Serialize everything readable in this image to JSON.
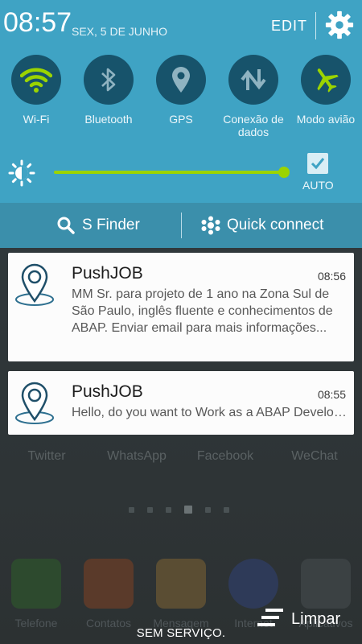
{
  "status": {
    "time": "08:57",
    "date": "SEX, 5 DE JUNHO",
    "edit_label": "EDIT"
  },
  "toggles": [
    {
      "label": "Wi-Fi",
      "icon": "wifi-icon",
      "active": true
    },
    {
      "label": "Bluetooth",
      "icon": "bluetooth-icon",
      "active": false
    },
    {
      "label": "GPS",
      "icon": "gps-icon",
      "active": false
    },
    {
      "label": "Conexão de dados",
      "icon": "data-connection-icon",
      "active": false
    },
    {
      "label": "Modo avião",
      "icon": "airplane-icon",
      "active": true
    }
  ],
  "brightness": {
    "level": 0.98,
    "auto_label": "AUTO",
    "auto_checked": true
  },
  "finder_bar": {
    "s_finder": "S Finder",
    "quick_connect": "Quick connect"
  },
  "notifications": [
    {
      "app": "PushJOB",
      "time": "08:56",
      "text": "MM Sr. para projeto de 1 ano na Zona Sul de São Paulo, inglês fluente e conhecimentos de ABAP. Enviar email para mais informações..."
    },
    {
      "app": "PushJOB",
      "time": "08:55",
      "text": "Hello, do you want to Work as a ABAP Developer?"
    }
  ],
  "home": {
    "apps": [
      "Twitter",
      "WhatsApp",
      "Facebook",
      "WeChat"
    ],
    "dock": [
      "Telefone",
      "Contatos",
      "Mensagem",
      "Internet",
      "Aplicativos"
    ]
  },
  "footer": {
    "clear_label": "Limpar",
    "service_label": "SEM SERVIÇO."
  },
  "colors": {
    "panel": "#3fa3c4",
    "toggle_bg": "#17536b",
    "active_accent": "#9bd400",
    "finder_bar": "#3b8fab"
  }
}
